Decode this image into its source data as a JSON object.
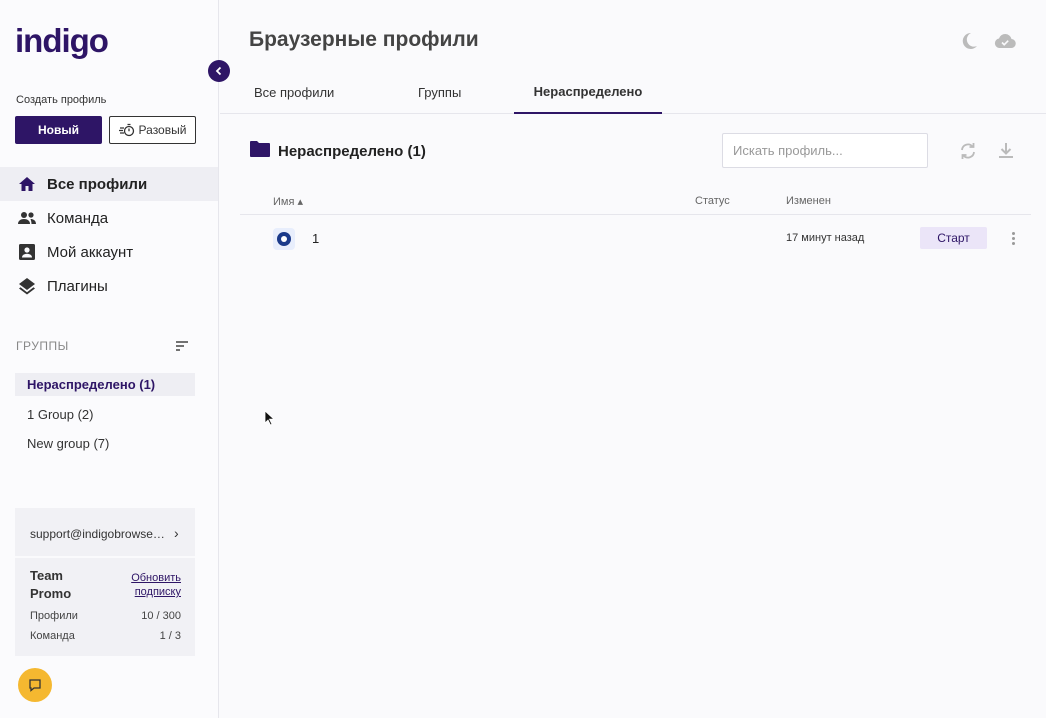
{
  "app": {
    "logo": "indigo"
  },
  "sidebar": {
    "create_label": "Создать профиль",
    "new_button": "Новый",
    "once_button": "Разовый",
    "nav": [
      {
        "label": "Все профили",
        "icon": "home-icon",
        "active": true
      },
      {
        "label": "Команда",
        "icon": "team-icon",
        "active": false
      },
      {
        "label": "Мой аккаунт",
        "icon": "account-icon",
        "active": false
      },
      {
        "label": "Плагины",
        "icon": "layers-icon",
        "active": false
      }
    ],
    "groups_title": "ГРУППЫ",
    "groups": [
      {
        "label": "Нераспределено  (1)",
        "active": true
      },
      {
        "label": "1 Group  (2)",
        "active": false
      },
      {
        "label": "New group  (7)",
        "active": false
      }
    ],
    "account": {
      "email": "support@indigobrowser.com",
      "plan": "Team Promo",
      "upgrade": "Обновить подписку",
      "stats": [
        {
          "label": "Профили",
          "value": "10 / 300"
        },
        {
          "label": "Команда",
          "value": "1 / 3"
        }
      ]
    }
  },
  "main": {
    "title": "Браузерные профили",
    "tabs": [
      {
        "label": "Все профили",
        "active": false
      },
      {
        "label": "Группы",
        "active": false
      },
      {
        "label": "Нераспределено",
        "active": true
      }
    ],
    "section_title": "Нераспределено (1)",
    "search_placeholder": "Искать профиль...",
    "columns": {
      "name": "Имя ▴",
      "status": "Статус",
      "changed": "Изменен"
    },
    "rows": [
      {
        "name": "1",
        "status": "",
        "changed": "17 минут назад",
        "action": "Старт"
      }
    ]
  },
  "colors": {
    "brand": "#2e1566",
    "accent": "#f5b830",
    "start_bg": "#ebe5f8"
  }
}
